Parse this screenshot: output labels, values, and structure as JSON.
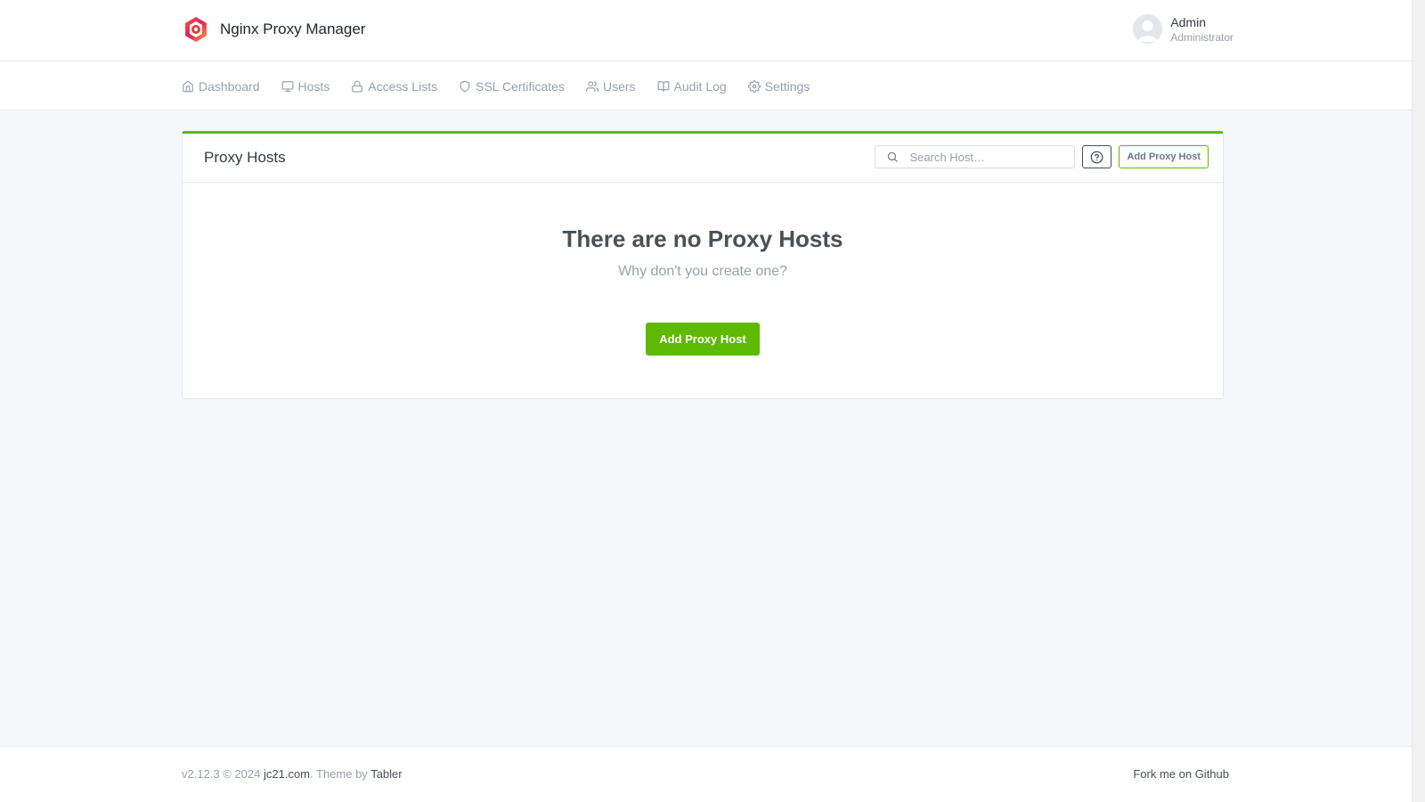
{
  "app": {
    "name": "Nginx Proxy Manager",
    "logo_icon": "nginx-proxy-manager-logo"
  },
  "user": {
    "name": "Admin",
    "role": "Administrator",
    "avatar_icon": "user-avatar-icon"
  },
  "nav": {
    "items": [
      {
        "label": "Dashboard",
        "icon": "home-icon"
      },
      {
        "label": "Hosts",
        "icon": "monitor-icon"
      },
      {
        "label": "Access Lists",
        "icon": "lock-icon"
      },
      {
        "label": "SSL Certificates",
        "icon": "shield-icon"
      },
      {
        "label": "Users",
        "icon": "users-icon"
      },
      {
        "label": "Audit Log",
        "icon": "book-icon"
      },
      {
        "label": "Settings",
        "icon": "gear-icon"
      }
    ]
  },
  "card": {
    "title": "Proxy Hosts",
    "search_placeholder": "Search Host…",
    "add_button_label": "Add Proxy Host",
    "empty_title": "There are no Proxy Hosts",
    "empty_subtitle": "Why don't you create one?",
    "empty_add_label": "Add Proxy Host"
  },
  "footer": {
    "version": "v2.12.3 © 2024 ",
    "author_link": "jc21.com",
    "theme_text": ". Theme by ",
    "theme_link": "Tabler",
    "fork_link": "Fork me on Github"
  },
  "colors": {
    "accent": "#5eba00",
    "background": "#f5f7fb",
    "muted": "#9aa0ac"
  }
}
